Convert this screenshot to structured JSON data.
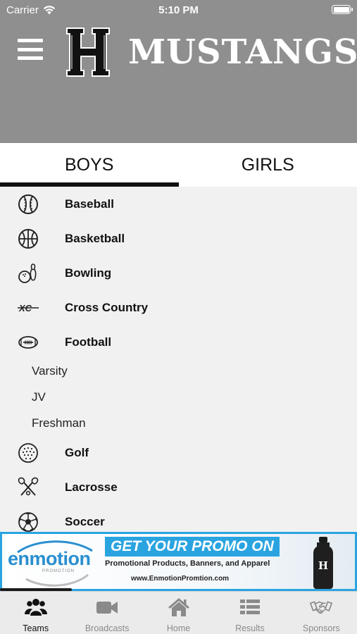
{
  "status_bar": {
    "carrier": "Carrier",
    "time": "5:10 PM"
  },
  "header": {
    "logo_letter": "H",
    "team_name": "MUSTANGS"
  },
  "tabs": [
    {
      "label": "BOYS",
      "active": true
    },
    {
      "label": "GIRLS",
      "active": false
    }
  ],
  "sports": [
    {
      "label": "Baseball",
      "icon": "baseball-icon"
    },
    {
      "label": "Basketball",
      "icon": "basketball-icon"
    },
    {
      "label": "Bowling",
      "icon": "bowling-icon"
    },
    {
      "label": "Cross Country",
      "icon": "cross-country-icon",
      "icon_text": "XC"
    },
    {
      "label": "Football",
      "icon": "football-icon",
      "sublevels": [
        "Varsity",
        "JV",
        "Freshman"
      ]
    },
    {
      "label": "Golf",
      "icon": "golf-ball-icon"
    },
    {
      "label": "Lacrosse",
      "icon": "lacrosse-sticks-icon"
    },
    {
      "label": "Soccer",
      "icon": "soccer-ball-icon"
    }
  ],
  "banner": {
    "brand": "enmotion",
    "brand_sub": "PROMOTION",
    "headline": "GET YOUR PROMO ON",
    "tagline": "Promotional Products, Banners, and Apparel",
    "url": "www.EnmotionPromtion.com",
    "bottle_letter": "H",
    "accent_color": "#2aa4e0"
  },
  "tabbar": [
    {
      "label": "Teams",
      "icon": "teams-icon",
      "active": true
    },
    {
      "label": "Broadcasts",
      "icon": "video-camera-icon",
      "active": false
    },
    {
      "label": "Home",
      "icon": "home-icon",
      "active": false
    },
    {
      "label": "Results",
      "icon": "list-icon",
      "active": false
    },
    {
      "label": "Sponsors",
      "icon": "handshake-icon",
      "active": false
    }
  ],
  "colors": {
    "header_bg": "#8f8f8f",
    "list_bg": "#f1f1f1",
    "active_tab": "#111111"
  }
}
